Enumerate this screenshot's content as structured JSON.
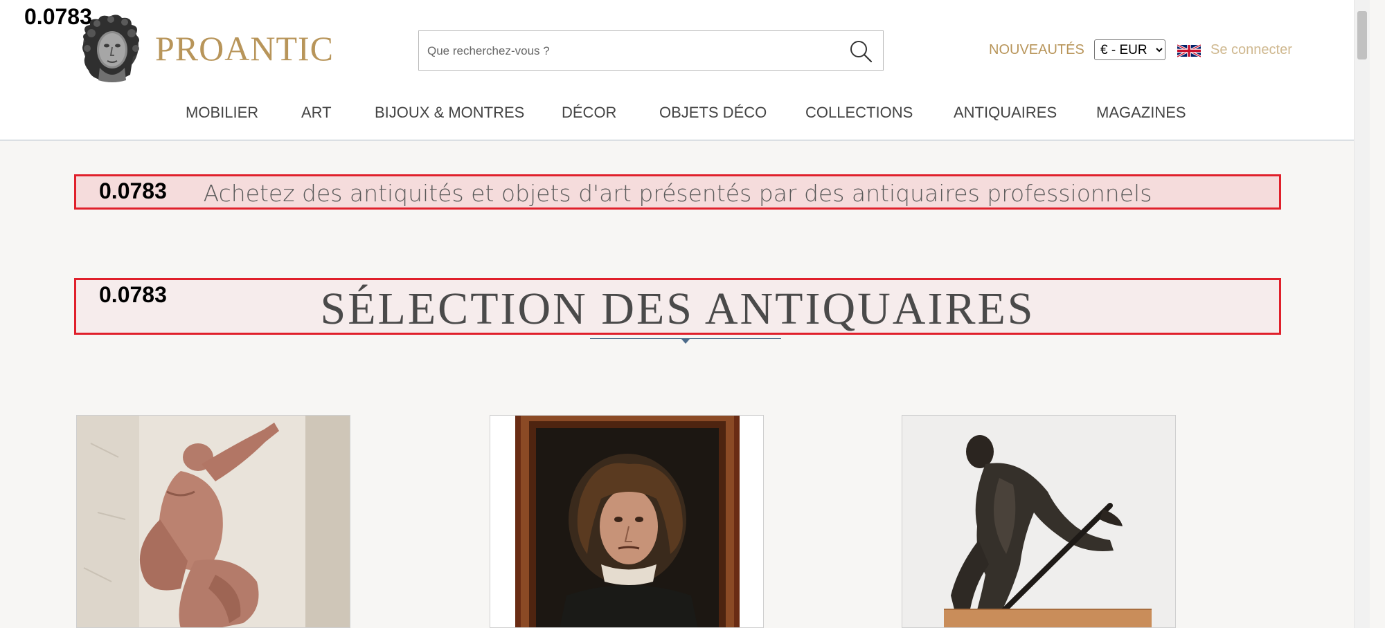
{
  "overlay": {
    "score_label": "0.0783"
  },
  "header": {
    "brand": "PROANTIC",
    "search": {
      "placeholder": "Que recherchez-vous ?"
    },
    "new_link": "NOUVEAUTÉS",
    "currency": {
      "selected": "€ - EUR"
    },
    "login": "Se connecter",
    "flag_icon": "uk-flag-icon"
  },
  "nav": {
    "items": [
      "MOBILIER",
      "ART",
      "BIJOUX & MONTRES",
      "DÉCOR",
      "OBJETS DÉCO",
      "COLLECTIONS",
      "ANTIQUAIRES",
      "MAGAZINES"
    ]
  },
  "main": {
    "tagline": "Achetez des antiquités et objets d'art présentés par des antiquaires professionnels",
    "section_title": "SÉLECTION DES ANTIQUAIRES",
    "cards": [
      {
        "image": "terracotta-sculpture-image"
      },
      {
        "image": "framed-portrait-painting-image"
      },
      {
        "image": "bronze-worker-statue-image"
      }
    ]
  },
  "colors": {
    "gold": "#b8955a",
    "highlight_border": "#e0202b",
    "highlight_fill": "#f5dcdc",
    "page_bg": "#f7f6f4"
  }
}
